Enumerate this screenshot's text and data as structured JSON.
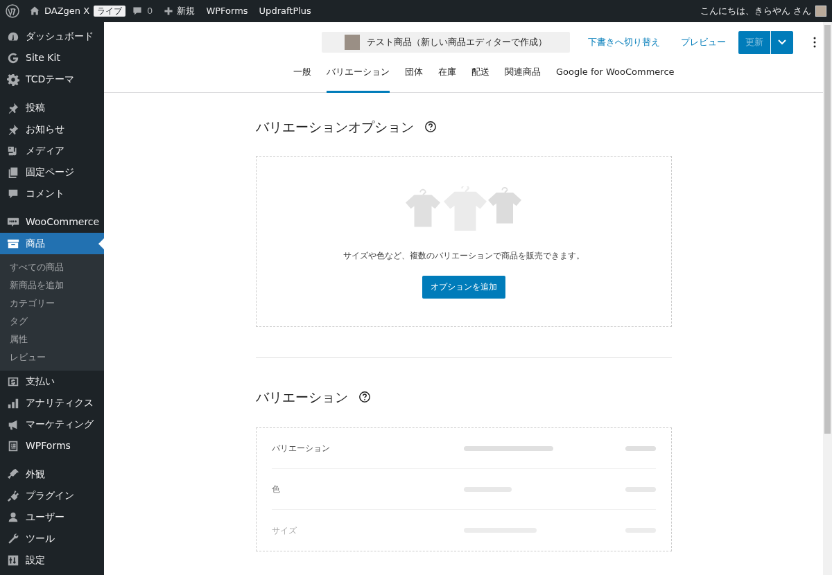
{
  "admin_bar": {
    "site_name": "DAZgen X",
    "live_badge": "ライブ",
    "comments_count": "0",
    "new_label": "新規",
    "links": [
      "WPForms",
      "UpdraftPlus"
    ],
    "greeting": "こんにちは、きらやん さん"
  },
  "sidebar": {
    "groups": [
      [
        {
          "label": "ダッシュボード",
          "selected": false
        },
        {
          "label": "Site Kit",
          "selected": false
        },
        {
          "label": "TCDテーマ",
          "selected": false
        }
      ],
      [
        {
          "label": "投稿",
          "selected": false
        },
        {
          "label": "お知らせ",
          "selected": false
        },
        {
          "label": "メディア",
          "selected": false
        },
        {
          "label": "固定ページ",
          "selected": false
        },
        {
          "label": "コメント",
          "selected": false
        }
      ],
      [
        {
          "label": "WooCommerce",
          "selected": false
        },
        {
          "label": "商品",
          "selected": true,
          "children": [
            {
              "label": "すべての商品",
              "selected": false
            },
            {
              "label": "新商品を追加",
              "selected": false
            },
            {
              "label": "カテゴリー",
              "selected": false
            },
            {
              "label": "タグ",
              "selected": false
            },
            {
              "label": "属性",
              "selected": false
            },
            {
              "label": "レビュー",
              "selected": false
            }
          ]
        },
        {
          "label": "支払い",
          "selected": false
        },
        {
          "label": "アナリティクス",
          "selected": false
        },
        {
          "label": "マーケティング",
          "selected": false
        },
        {
          "label": "WPForms",
          "selected": false
        }
      ],
      [
        {
          "label": "外観",
          "selected": false
        },
        {
          "label": "プラグイン",
          "selected": false
        },
        {
          "label": "ユーザー",
          "selected": false
        },
        {
          "label": "ツール",
          "selected": false
        },
        {
          "label": "設定",
          "selected": false
        }
      ]
    ]
  },
  "header": {
    "product_title": "テスト商品（新しい商品エディターで作成）",
    "switch_to_draft": "下書きへ切り替え",
    "preview": "プレビュー",
    "update_button": {
      "label": "更新",
      "disabled": true
    }
  },
  "tabs": [
    {
      "label": "一般",
      "selected": false
    },
    {
      "label": "バリエーション",
      "selected": true
    },
    {
      "label": "団体",
      "selected": false
    },
    {
      "label": "在庫",
      "selected": false
    },
    {
      "label": "配送",
      "selected": false
    },
    {
      "label": "関連商品",
      "selected": false
    },
    {
      "label": "Google for WooCommerce",
      "selected": false
    }
  ],
  "variation_options": {
    "heading": "バリエーションオプション",
    "message": "サイズや色など、複数のバリエーションで商品を販売できます。",
    "button": "オプションを追加"
  },
  "variations": {
    "heading": "バリエーション",
    "rows": [
      "バリエーション",
      "色",
      "サイズ"
    ]
  }
}
